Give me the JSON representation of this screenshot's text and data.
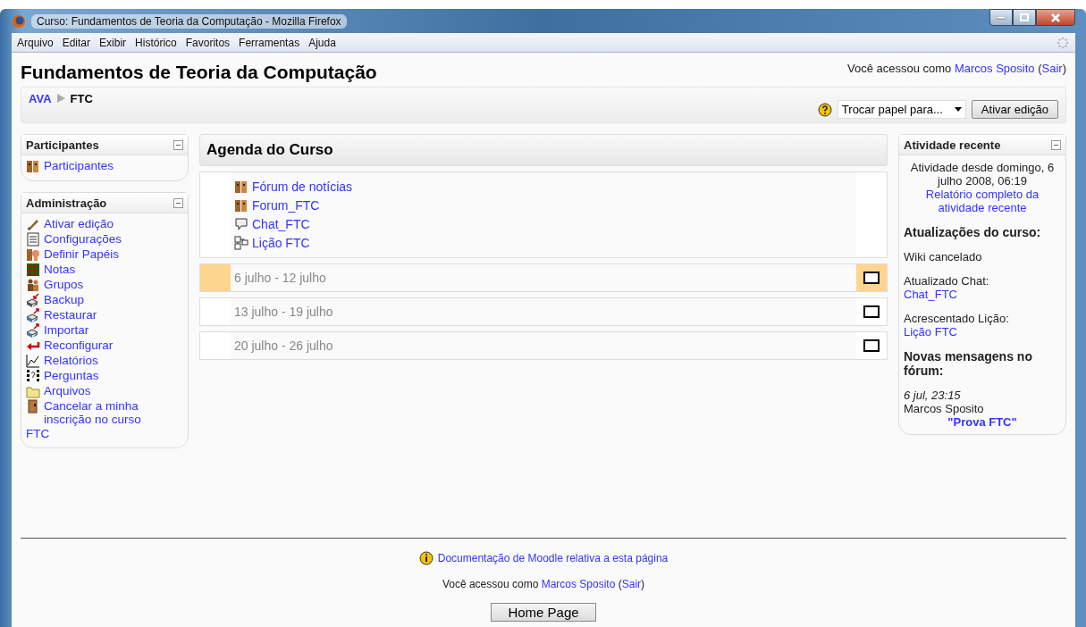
{
  "window": {
    "title": "Curso: Fundamentos de Teoria da Computação - Mozilla Firefox"
  },
  "menu": [
    "Arquivo",
    "Editar",
    "Exibir",
    "Histórico",
    "Favoritos",
    "Ferramentas",
    "Ajuda"
  ],
  "header": {
    "title": "Fundamentos de Teoria da Computação",
    "login_prefix": "Você acessou como",
    "user": "Marcos Sposito",
    "paren_open": "(",
    "logout": "Sair",
    "paren_close": ")"
  },
  "breadcrumb": [
    {
      "label": "AVA",
      "link": true
    },
    {
      "label": "FTC",
      "link": false
    }
  ],
  "role_select": {
    "value": "Trocar papel para..."
  },
  "edit_button": "Ativar edição",
  "left_blocks": [
    {
      "title": "Participantes",
      "items": [
        {
          "kind": "people",
          "label": "Participantes"
        }
      ]
    },
    {
      "title": "Administração",
      "items": [
        {
          "kind": "edit",
          "label": "Ativar edição"
        },
        {
          "kind": "settings",
          "label": "Configurações"
        },
        {
          "kind": "roles",
          "label": "Definir Papéis"
        },
        {
          "kind": "grades",
          "label": "Notas"
        },
        {
          "kind": "groups",
          "label": "Grupos"
        },
        {
          "kind": "backup",
          "label": "Backup"
        },
        {
          "kind": "restore",
          "label": "Restaurar"
        },
        {
          "kind": "import",
          "label": "Importar"
        },
        {
          "kind": "reset",
          "label": "Reconfigurar"
        },
        {
          "kind": "reports",
          "label": "Relatórios"
        },
        {
          "kind": "questions",
          "label": "Perguntas"
        },
        {
          "kind": "files",
          "label": "Arquivos"
        },
        {
          "kind": "unenrol",
          "label": "Cancelar a minha inscrição no curso",
          "tail": "FTC"
        }
      ]
    }
  ],
  "agenda": {
    "title": "Agenda do Curso",
    "activities": [
      {
        "kind": "forum",
        "label": "Fórum de notícias"
      },
      {
        "kind": "forum",
        "label": "Forum_FTC"
      },
      {
        "kind": "chat",
        "label": "Chat_FTC"
      },
      {
        "kind": "lesson",
        "label": "Lição FTC"
      }
    ],
    "weeks": [
      {
        "label": "6 julho - 12 julho",
        "selected": true
      },
      {
        "label": "13 julho - 19 julho",
        "selected": false
      },
      {
        "label": "20 julho - 26 julho",
        "selected": false
      }
    ]
  },
  "recent": {
    "title": "Atividade recente",
    "since": "Atividade desde domingo, 6 julho 2008, 06:19",
    "report_link": "Relatório completo da atividade recente",
    "updates_heading": "Atualizações do curso:",
    "updates": [
      {
        "text": "Wiki cancelado"
      },
      {
        "text": "Atualizado Chat:",
        "link": "Chat_FTC"
      },
      {
        "text": "Acrescentado Lição:",
        "link": "Lição FTC"
      }
    ],
    "forum_heading": "Novas mensagens no fórum:",
    "post": {
      "date": "6 jul, 23:15",
      "author": "Marcos Sposito",
      "title": "\"Prova FTC\""
    }
  },
  "footer": {
    "doc_link": "Documentação de Moodle relativa a esta página",
    "login_prefix": "Você acessou como",
    "user": "Marcos Sposito",
    "paren_open": "(",
    "logout": "Sair",
    "paren_close": ")",
    "home_button": "Home Page"
  }
}
